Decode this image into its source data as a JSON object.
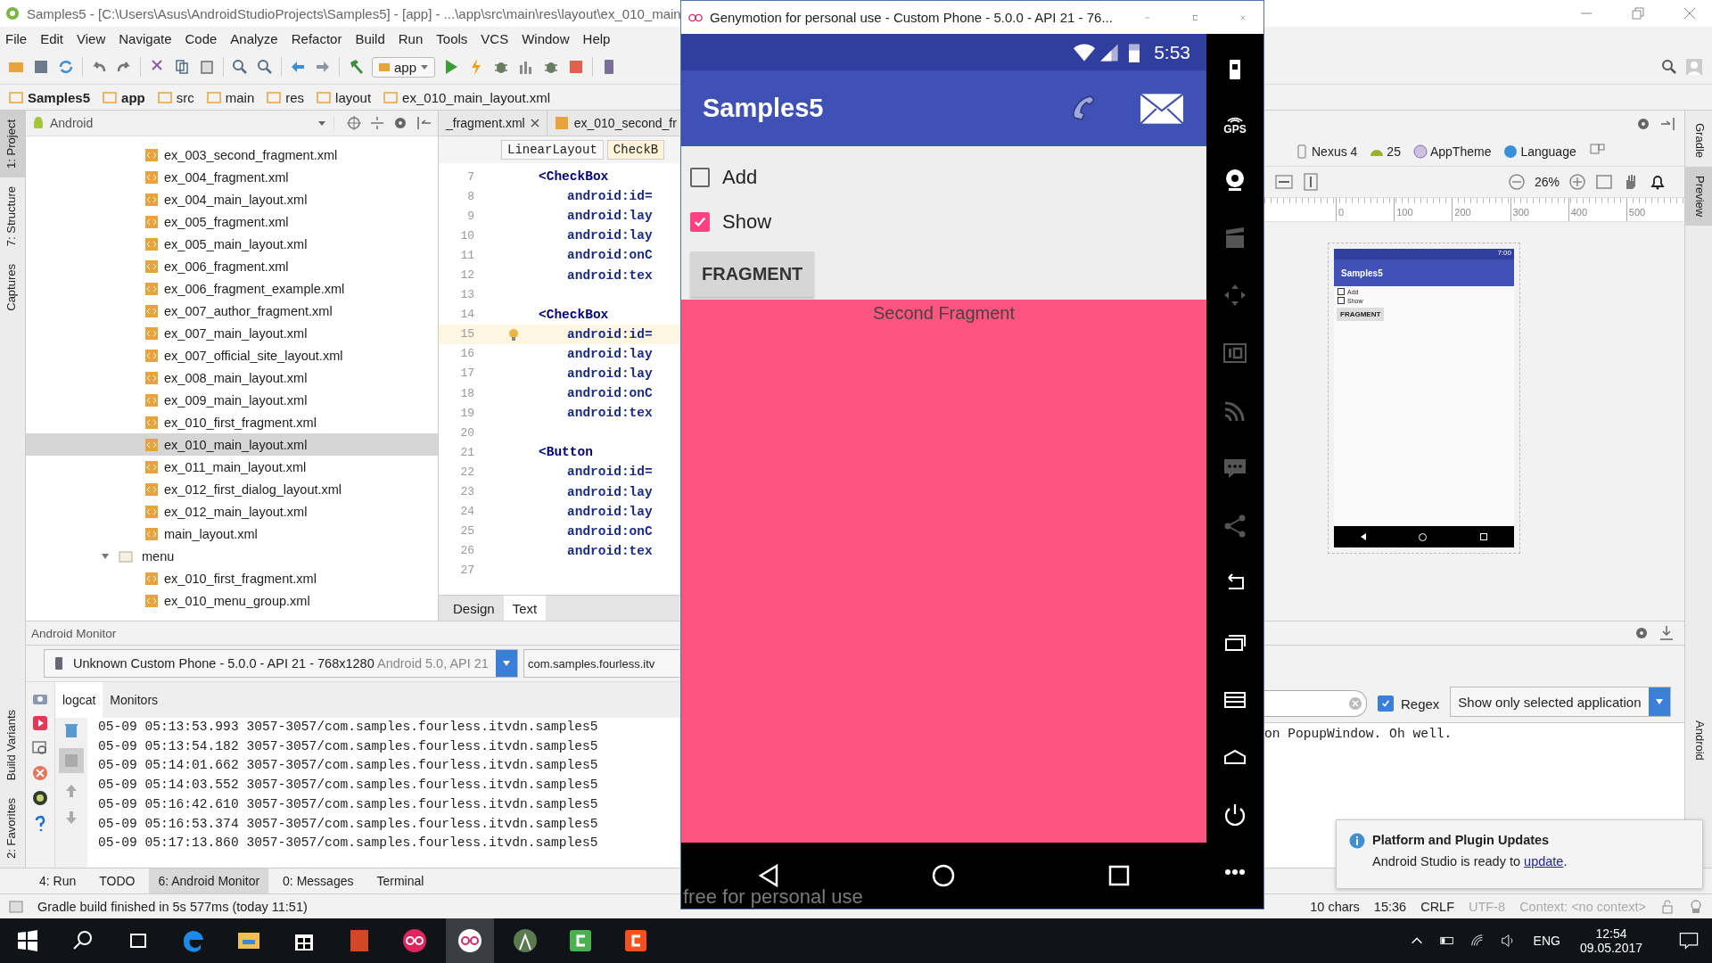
{
  "ide": {
    "title": "Samples5 - [C:\\Users\\Asus\\AndroidStudioProjects\\Samples5] - [app] - ...\\app\\src\\main\\res\\layout\\ex_010_main",
    "menu": [
      "File",
      "Edit",
      "View",
      "Navigate",
      "Code",
      "Analyze",
      "Refactor",
      "Build",
      "Run",
      "Tools",
      "VCS",
      "Window",
      "Help"
    ],
    "run_config": "app",
    "breadcrumbs": [
      "Samples5",
      "app",
      "src",
      "main",
      "res",
      "layout",
      "ex_010_main_layout.xml"
    ],
    "left_tool_tabs_top": [
      {
        "label": "1: Project",
        "selected": true
      },
      {
        "label": "7: Structure",
        "selected": false
      },
      {
        "label": "Captures",
        "selected": false
      }
    ],
    "left_tool_tabs_bottom": [
      {
        "label": "Build Variants",
        "selected": false
      },
      {
        "label": "2: Favorites",
        "selected": false
      }
    ],
    "project_view": "Android",
    "tree": [
      {
        "label": "ex_003_second_fragment.xml",
        "selected": false
      },
      {
        "label": "ex_004_fragment.xml",
        "selected": false
      },
      {
        "label": "ex_004_main_layout.xml",
        "selected": false
      },
      {
        "label": "ex_005_fragment.xml",
        "selected": false
      },
      {
        "label": "ex_005_main_layout.xml",
        "selected": false
      },
      {
        "label": "ex_006_fragment.xml",
        "selected": false
      },
      {
        "label": "ex_006_fragment_example.xml",
        "selected": false
      },
      {
        "label": "ex_007_author_fragment.xml",
        "selected": false
      },
      {
        "label": "ex_007_main_layout.xml",
        "selected": false
      },
      {
        "label": "ex_007_official_site_layout.xml",
        "selected": false
      },
      {
        "label": "ex_008_main_layout.xml",
        "selected": false
      },
      {
        "label": "ex_009_main_layout.xml",
        "selected": false
      },
      {
        "label": "ex_010_first_fragment.xml",
        "selected": false
      },
      {
        "label": "ex_010_main_layout.xml",
        "selected": true
      },
      {
        "label": "ex_011_main_layout.xml",
        "selected": false
      },
      {
        "label": "ex_012_first_dialog_layout.xml",
        "selected": false
      },
      {
        "label": "ex_012_main_layout.xml",
        "selected": false
      },
      {
        "label": "main_layout.xml",
        "selected": false
      },
      {
        "label": "menu",
        "kind": "folder",
        "expanded": true,
        "selected": false,
        "children": [
          {
            "label": "ex_010_first_fragment.xml",
            "selected": false
          },
          {
            "label": "ex_010_menu_group.xml",
            "selected": false
          }
        ]
      }
    ],
    "editor_tabs": [
      {
        "label": "_fragment.xml",
        "selected": false
      },
      {
        "label": "ex_010_second_fr",
        "selected": false
      }
    ],
    "component_path": [
      "LinearLayout",
      "CheckB"
    ],
    "code_lines": [
      {
        "number": "7",
        "kind": "tag",
        "text": "<CheckBox",
        "highlighted": false
      },
      {
        "number": "8",
        "kind": "attr",
        "text": "android:id=",
        "highlighted": false
      },
      {
        "number": "9",
        "kind": "attr",
        "text": "android:lay",
        "highlighted": false
      },
      {
        "number": "10",
        "kind": "attr",
        "text": "android:lay",
        "highlighted": false
      },
      {
        "number": "11",
        "kind": "attr",
        "text": "android:onC",
        "highlighted": false
      },
      {
        "number": "12",
        "kind": "attr",
        "text": "android:tex",
        "highlighted": false
      },
      {
        "number": "13",
        "kind": "blank",
        "highlighted": false
      },
      {
        "number": "14",
        "kind": "tag",
        "text": "<CheckBox",
        "highlighted": false
      },
      {
        "number": "15",
        "kind": "attr",
        "text": "android:id=",
        "highlighted": true
      },
      {
        "number": "16",
        "kind": "attr",
        "text": "android:lay",
        "highlighted": false
      },
      {
        "number": "17",
        "kind": "attr",
        "text": "android:lay",
        "highlighted": false
      },
      {
        "number": "18",
        "kind": "attr",
        "text": "android:onC",
        "highlighted": false
      },
      {
        "number": "19",
        "kind": "attr",
        "text": "android:tex",
        "highlighted": false
      },
      {
        "number": "20",
        "kind": "blank",
        "highlighted": false
      },
      {
        "number": "21",
        "kind": "tag",
        "text": "<Button",
        "highlighted": false
      },
      {
        "number": "22",
        "kind": "attr",
        "text": "android:id=",
        "highlighted": false
      },
      {
        "number": "23",
        "kind": "attr",
        "text": "android:lay",
        "highlighted": false
      },
      {
        "number": "24",
        "kind": "attr",
        "text": "android:lay",
        "highlighted": false
      },
      {
        "number": "25",
        "kind": "attr",
        "text": "android:onC",
        "highlighted": false
      },
      {
        "number": "26",
        "kind": "attr",
        "text": "android:tex",
        "highlighted": false
      },
      {
        "number": "27",
        "kind": "blank",
        "highlighted": false
      }
    ],
    "editor_modes": [
      {
        "label": "Design",
        "selected": false
      },
      {
        "label": "Text",
        "selected": true
      }
    ],
    "designer": {
      "device": "Nexus 4",
      "api": "25",
      "theme": "AppTheme",
      "language": "Language",
      "zoom": "26%",
      "ruler": [
        "0",
        "100",
        "200",
        "300",
        "400",
        "500"
      ],
      "preview": {
        "time": "7:00",
        "app_title": "Samples5",
        "checkboxes": [
          {
            "label": "Add",
            "checked": false
          },
          {
            "label": "Show",
            "checked": false
          }
        ],
        "button": "FRAGMENT"
      }
    },
    "right_tool_tabs_top": [
      {
        "label": "Gradle",
        "selected": false
      },
      {
        "label": "Preview",
        "selected": true
      }
    ],
    "right_tool_tab_bottom": {
      "label": "Android",
      "selected": false
    },
    "monitor": {
      "title": "Android Monitor",
      "device": "Unknown Custom Phone - 5.0.0 - API 21 - 768x1280",
      "device_detail": "Android 5.0, API 21",
      "process": "com.samples.fourless.itv",
      "tabs": [
        {
          "label": "logcat",
          "selected": true
        },
        {
          "label": "Monitors",
          "selected": false
        }
      ],
      "log": [
        "05-09 05:13:53.993 3057-3057/com.samples.fourless.itvdn.samples5",
        "05-09 05:13:54.182 3057-3057/com.samples.fourless.itvdn.samples5",
        "05-09 05:14:01.662 3057-3057/com.samples.fourless.itvdn.samples5",
        "05-09 05:14:03.552 3057-3057/com.samples.fourless.itvdn.samples5",
        "05-09 05:16:42.610 3057-3057/com.samples.fourless.itvdn.samples5",
        "05-09 05:16:53.374 3057-3057/com.samples.fourless.itvdn.samples5",
        "05-09 05:17:13.860 3057-3057/com.samples.fourless.itvdn.samples5"
      ],
      "log_tail": "on PopupWindow. Oh well.",
      "regex": {
        "label": "Regex",
        "checked": true
      },
      "filter": "Show only selected application"
    },
    "bottom_tabs": [
      {
        "label": "4: Run",
        "selected": false
      },
      {
        "label": "TODO",
        "selected": false
      },
      {
        "label": "6: Android Monitor",
        "selected": true
      },
      {
        "label": "0: Messages",
        "selected": false
      },
      {
        "label": "Terminal",
        "selected": false
      }
    ],
    "status": {
      "message": "Gradle build finished in 5s 577ms (today 11:51)",
      "chars": "10 chars",
      "position": "15:36",
      "line_separator": "CRLF",
      "encoding": "UTF-8",
      "context": "Context: <no context>"
    },
    "notification": {
      "title": "Platform and Plugin Updates",
      "text": "Android Studio is ready to ",
      "link": "update",
      "text_end": "."
    }
  },
  "emulator": {
    "title": "Genymotion for personal use - Custom Phone - 5.0.0 - API 21 - 76...",
    "time": "5:53",
    "app_title": "Samples5",
    "checkboxes": [
      {
        "label": "Add",
        "checked": false
      },
      {
        "label": "Show",
        "checked": true
      }
    ],
    "button": "FRAGMENT",
    "fragment_text": "Second Fragment",
    "overlay_text": "free for personal use",
    "gps_label": "GPS"
  },
  "taskbar": {
    "language": "ENG",
    "time": "12:54",
    "date": "09.05.2017"
  }
}
